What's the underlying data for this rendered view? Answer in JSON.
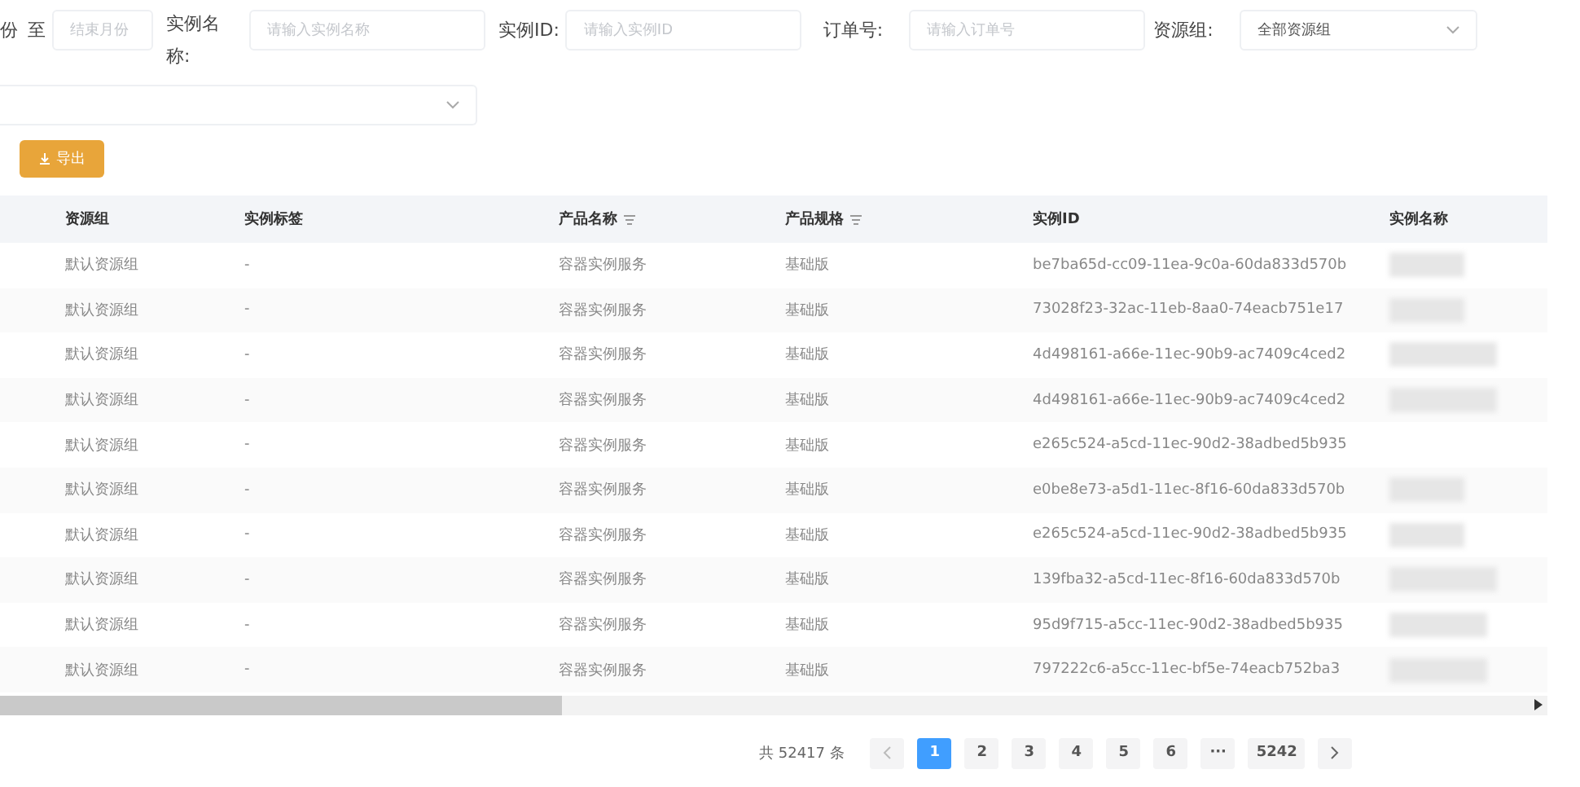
{
  "filters": {
    "month_end": {
      "cut_label": "份",
      "separator": "至",
      "placeholder": "结束月份"
    },
    "fields": [
      {
        "label": "实例名称:",
        "placeholder": "请输入实例名称"
      },
      {
        "label": "实例ID:",
        "placeholder": "请输入实例ID"
      },
      {
        "label": "订单号:",
        "placeholder": "请输入订单号"
      }
    ],
    "resource_group": {
      "label": "资源组:",
      "value": "全部资源组"
    }
  },
  "export_button": {
    "label": "导出"
  },
  "table": {
    "columns": [
      {
        "label": "资源组",
        "filterable": false
      },
      {
        "label": "实例标签",
        "filterable": false
      },
      {
        "label": "产品名称",
        "filterable": true
      },
      {
        "label": "产品规格",
        "filterable": true
      },
      {
        "label": "实例ID",
        "filterable": false
      },
      {
        "label": "实例名称",
        "filterable": false
      }
    ],
    "rows": [
      {
        "group": "默认资源组",
        "tag": "-",
        "product": "容器实例服务",
        "spec": "基础版",
        "id": "be7ba65d-cc09-11ea-9c0a-60da833d570b"
      },
      {
        "group": "默认资源组",
        "tag": "-",
        "product": "容器实例服务",
        "spec": "基础版",
        "id": "73028f23-32ac-11eb-8aa0-74eacb751e17"
      },
      {
        "group": "默认资源组",
        "tag": "-",
        "product": "容器实例服务",
        "spec": "基础版",
        "id": "4d498161-a66e-11ec-90b9-ac7409c4ced2"
      },
      {
        "group": "默认资源组",
        "tag": "-",
        "product": "容器实例服务",
        "spec": "基础版",
        "id": "4d498161-a66e-11ec-90b9-ac7409c4ced2"
      },
      {
        "group": "默认资源组",
        "tag": "-",
        "product": "容器实例服务",
        "spec": "基础版",
        "id": "e265c524-a5cd-11ec-90d2-38adbed5b935"
      },
      {
        "group": "默认资源组",
        "tag": "-",
        "product": "容器实例服务",
        "spec": "基础版",
        "id": "e0be8e73-a5d1-11ec-8f16-60da833d570b"
      },
      {
        "group": "默认资源组",
        "tag": "-",
        "product": "容器实例服务",
        "spec": "基础版",
        "id": "e265c524-a5cd-11ec-90d2-38adbed5b935"
      },
      {
        "group": "默认资源组",
        "tag": "-",
        "product": "容器实例服务",
        "spec": "基础版",
        "id": "139fba32-a5cd-11ec-8f16-60da833d570b"
      },
      {
        "group": "默认资源组",
        "tag": "-",
        "product": "容器实例服务",
        "spec": "基础版",
        "id": "95d9f715-a5cc-11ec-90d2-38adbed5b935"
      },
      {
        "group": "默认资源组",
        "tag": "-",
        "product": "容器实例服务",
        "spec": "基础版",
        "id": "797222c6-a5cc-11ec-bf5e-74eacb752ba3"
      }
    ]
  },
  "pagination": {
    "total": "共 52417 条",
    "pages": [
      {
        "label": "1",
        "selected": true
      },
      {
        "label": "2",
        "selected": false
      },
      {
        "label": "3",
        "selected": false
      },
      {
        "label": "4",
        "selected": false
      },
      {
        "label": "5",
        "selected": false
      },
      {
        "label": "6",
        "selected": false
      },
      {
        "label": "···",
        "selected": false
      },
      {
        "label": "5242",
        "selected": false
      }
    ]
  }
}
